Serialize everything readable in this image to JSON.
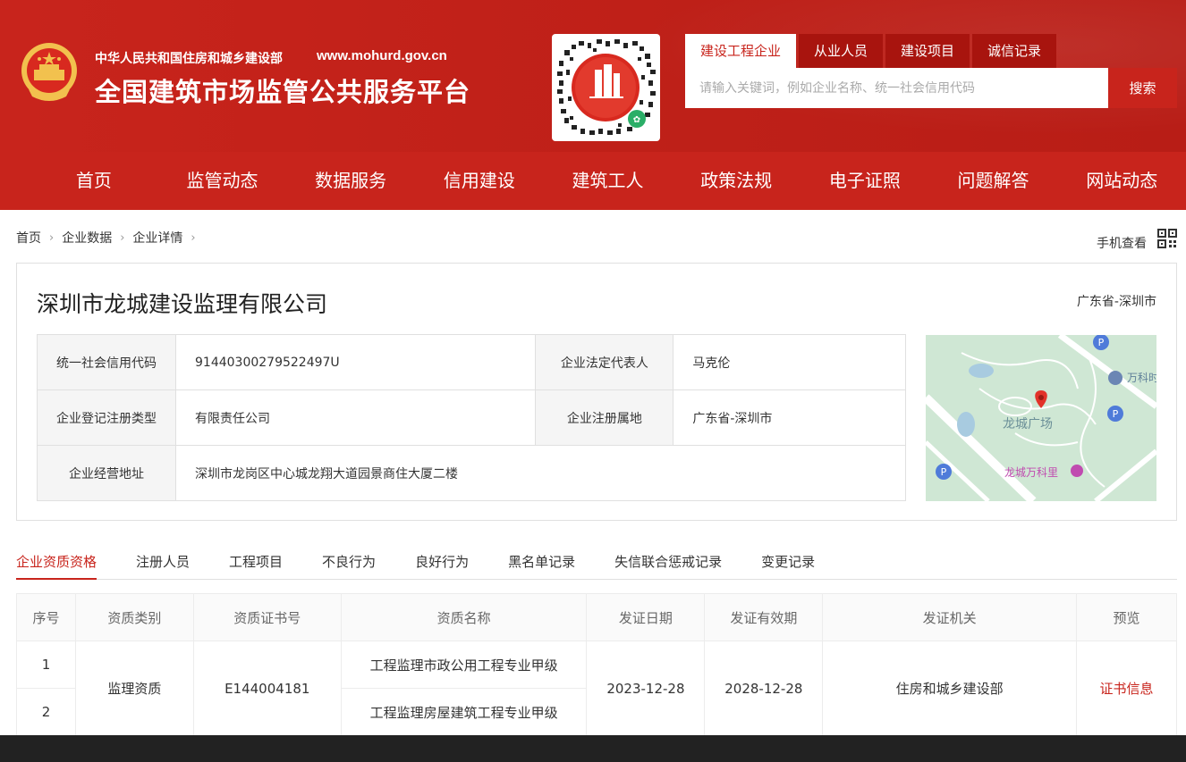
{
  "header": {
    "ministry": "中华人民共和国住房和城乡建设部",
    "domain": "www.mohurd.gov.cn",
    "site_title": "全国建筑市场监管公共服务平台"
  },
  "search": {
    "tabs": [
      "建设工程企业",
      "从业人员",
      "建设项目",
      "诚信记录"
    ],
    "active_tab": 0,
    "placeholder": "请输入关键词，例如企业名称、统一社会信用代码",
    "button_label": "搜索"
  },
  "nav": {
    "items": [
      "首页",
      "监管动态",
      "数据服务",
      "信用建设",
      "建筑工人",
      "政策法规",
      "电子证照",
      "问题解答",
      "网站动态"
    ]
  },
  "breadcrumb": {
    "items": [
      "首页",
      "企业数据",
      "企业详情"
    ],
    "mobile_label": "手机查看"
  },
  "company": {
    "name": "深圳市龙城建设监理有限公司",
    "region": "广东省-深圳市",
    "credit_code_label": "统一社会信用代码",
    "credit_code": "91440300279522497U",
    "legal_rep_label": "企业法定代表人",
    "legal_rep": "马克伦",
    "reg_type_label": "企业登记注册类型",
    "reg_type": "有限责任公司",
    "reg_place_label": "企业注册属地",
    "reg_place": "广东省-深圳市",
    "address_label": "企业经营地址",
    "address": "深圳市龙岗区中心城龙翔大道园景商住大厦二楼"
  },
  "map": {
    "label_main": "龙城广场",
    "label_mall": "龙城万科里",
    "label_vanke": "万科时"
  },
  "detail_tabs": {
    "items": [
      "企业资质资格",
      "注册人员",
      "工程项目",
      "不良行为",
      "良好行为",
      "黑名单记录",
      "失信联合惩戒记录",
      "变更记录"
    ],
    "active": 0
  },
  "qualifications": {
    "headers": [
      "序号",
      "资质类别",
      "资质证书号",
      "资质名称",
      "发证日期",
      "发证有效期",
      "发证机关",
      "预览"
    ],
    "category": "监理资质",
    "cert_no": "E144004181",
    "issue_date": "2023-12-28",
    "valid_until": "2028-12-28",
    "authority": "住房和城乡建设部",
    "preview": "证书信息",
    "rows": [
      {
        "index": "1",
        "name": "工程监理市政公用工程专业甲级"
      },
      {
        "index": "2",
        "name": "工程监理房屋建筑工程专业甲级"
      }
    ]
  },
  "colors": {
    "brand_red": "#c8241c",
    "tab_dark_red": "#a8140e"
  }
}
